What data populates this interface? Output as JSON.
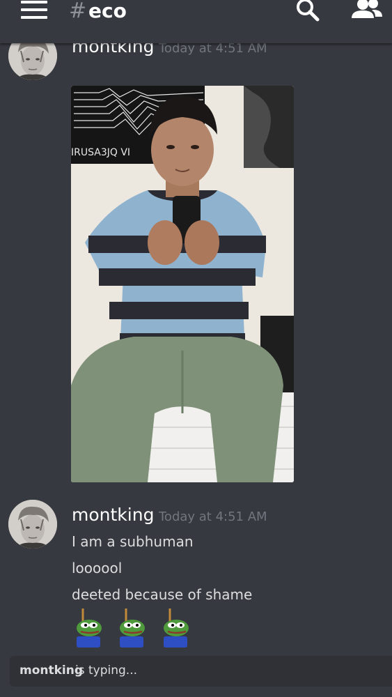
{
  "header": {
    "channel_hash": "#",
    "channel_name": "eco",
    "icons": [
      "menu-icon",
      "search-icon",
      "members-icon"
    ]
  },
  "messages": [
    {
      "author": "montking",
      "timestamp": "Today at 4:51 AM",
      "attachment": "image"
    },
    {
      "author": "montking",
      "timestamp": "Today at 4:51 AM",
      "lines": [
        "I am a subhuman",
        "loooool",
        "deeted because of shame"
      ],
      "emojis": [
        "hanging-pepe-emoji",
        "hanging-pepe-emoji",
        "hanging-pepe-emoji"
      ]
    }
  ],
  "typing": {
    "user": "montking",
    "text": "is typing..."
  },
  "colors": {
    "background": "#36393f",
    "typing_bar": "#2f3136",
    "timestamp": "#72767d",
    "text": "#dcddde"
  }
}
